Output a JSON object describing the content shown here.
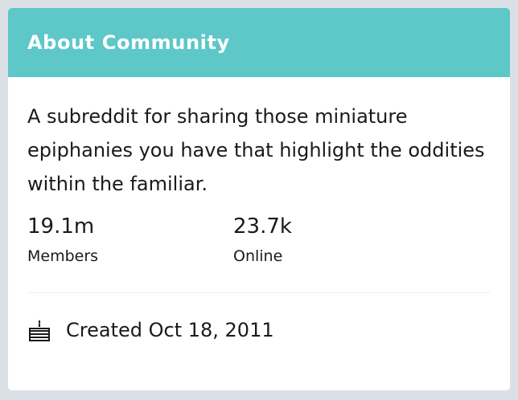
{
  "about": {
    "title": "About Community",
    "description": "A subreddit for sharing those miniature epiphanies you have that highlight the oddities within the familiar.",
    "stats": [
      {
        "value": "19.1m",
        "label": "Members"
      },
      {
        "value": "23.7k",
        "label": "Online"
      }
    ],
    "created": "Created Oct 18, 2011",
    "created_icon": "cake-icon",
    "colors": {
      "header_bg": "#5ec7c8",
      "header_text": "#ffffff",
      "body_text": "#1a1a1b",
      "card_bg": "#ffffff",
      "page_bg": "#dae0e6"
    }
  }
}
